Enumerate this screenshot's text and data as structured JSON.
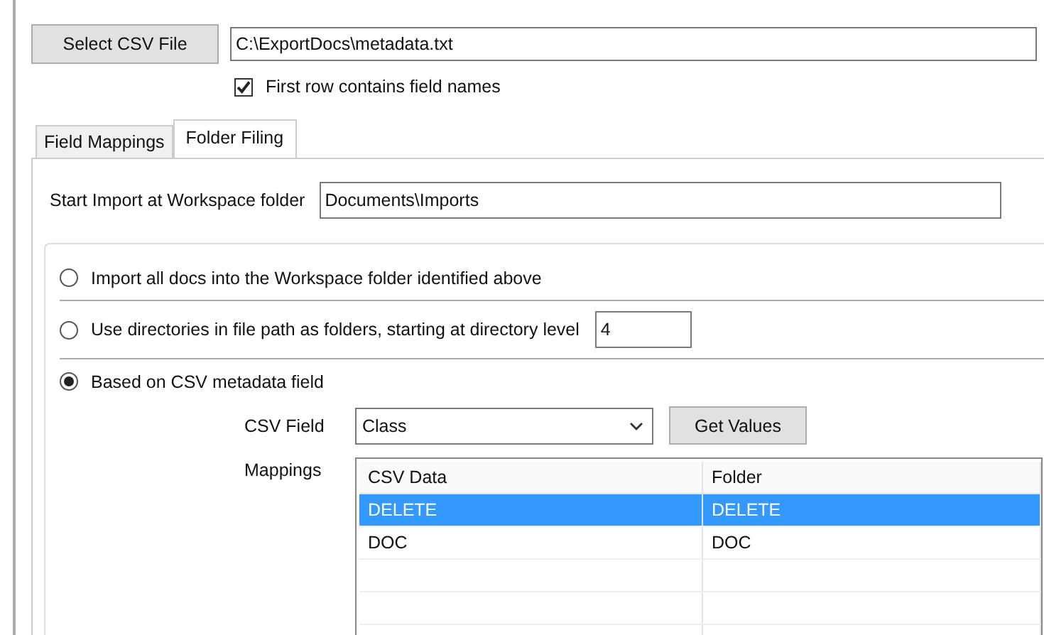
{
  "file": {
    "button": "Select CSV File",
    "path": "C:\\ExportDocs\\metadata.txt",
    "header_checkbox": {
      "label": "First row contains field names",
      "checked": true
    }
  },
  "tabs": [
    {
      "label": "Field Mappings",
      "selected": false
    },
    {
      "label": "Folder Filing",
      "selected": true
    }
  ],
  "start_folder": {
    "label": "Start Import at Workspace folder",
    "value": "Documents\\Imports"
  },
  "options": [
    {
      "kind": "plain",
      "label": "Import all docs into the Workspace folder identified above",
      "selected": false
    },
    {
      "kind": "level",
      "label": "Use directories in file path as folders, starting at directory level",
      "value": "4",
      "selected": false
    },
    {
      "kind": "csv",
      "label": "Based on CSV metadata field",
      "selected": true
    }
  ],
  "csv_field": {
    "label": "CSV Field",
    "value": "Class",
    "button": "Get Values"
  },
  "mappings": {
    "label": "Mappings",
    "columns": [
      "CSV Data",
      "Folder"
    ],
    "rows": [
      {
        "cells": [
          "DELETE",
          "DELETE"
        ],
        "selected": true
      },
      {
        "cells": [
          "DOC",
          "DOC"
        ],
        "selected": false
      }
    ]
  }
}
